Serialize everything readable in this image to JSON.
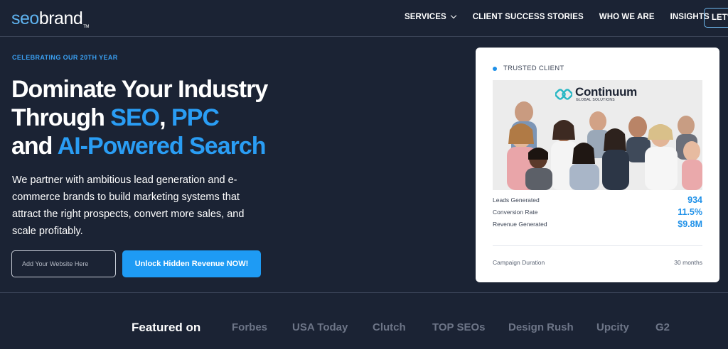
{
  "header": {
    "logo_seo": "seo",
    "logo_brand": "brand",
    "logo_tm": "TM",
    "nav": [
      {
        "label": "SERVICES"
      },
      {
        "label": "CLIENT SUCCESS STORIES"
      },
      {
        "label": "WHO WE ARE"
      },
      {
        "label": "INSIGHTS"
      }
    ],
    "cta_label": "LET'S"
  },
  "hero": {
    "eyebrow": "CELEBRATING OUR 20TH YEAR",
    "headline_1": "Dominate Your Industry",
    "headline_2a": "Through ",
    "headline_2b": "SEO",
    "headline_2c": ", ",
    "headline_2d": "PPC",
    "headline_3a": "and ",
    "headline_3b": "AI-Powered Search",
    "subtext": "We partner with ambitious lead generation and e-commerce brands to build marketing systems that attract the right prospects, convert more sales, and scale profitably.",
    "input_placeholder": "Add Your Website Here",
    "button_label": "Unlock Hidden Revenue NOW!"
  },
  "card": {
    "tag": "TRUSTED CLIENT",
    "client_name": "Continuum",
    "client_sub": "GLOBAL SOLUTIONS",
    "stats": [
      {
        "label": "Leads Generated",
        "value": "934"
      },
      {
        "label": "Conversion Rate",
        "value": "11.5%"
      },
      {
        "label": "Revenue Generated",
        "value": "$9.8M"
      }
    ],
    "duration_label": "Campaign Duration",
    "duration_value": "30 months"
  },
  "featured": {
    "title": "Featured on",
    "logos": [
      "Forbes",
      "USA Today",
      "Clutch",
      "TOP SEOs",
      "Design Rush",
      "Upcity",
      "G2"
    ]
  },
  "colors": {
    "background": "#1b2334",
    "accent": "#1e9bf4",
    "highlight": "#2a9df4",
    "card_bg": "#ffffff",
    "muted_logo": "#6d7587"
  }
}
